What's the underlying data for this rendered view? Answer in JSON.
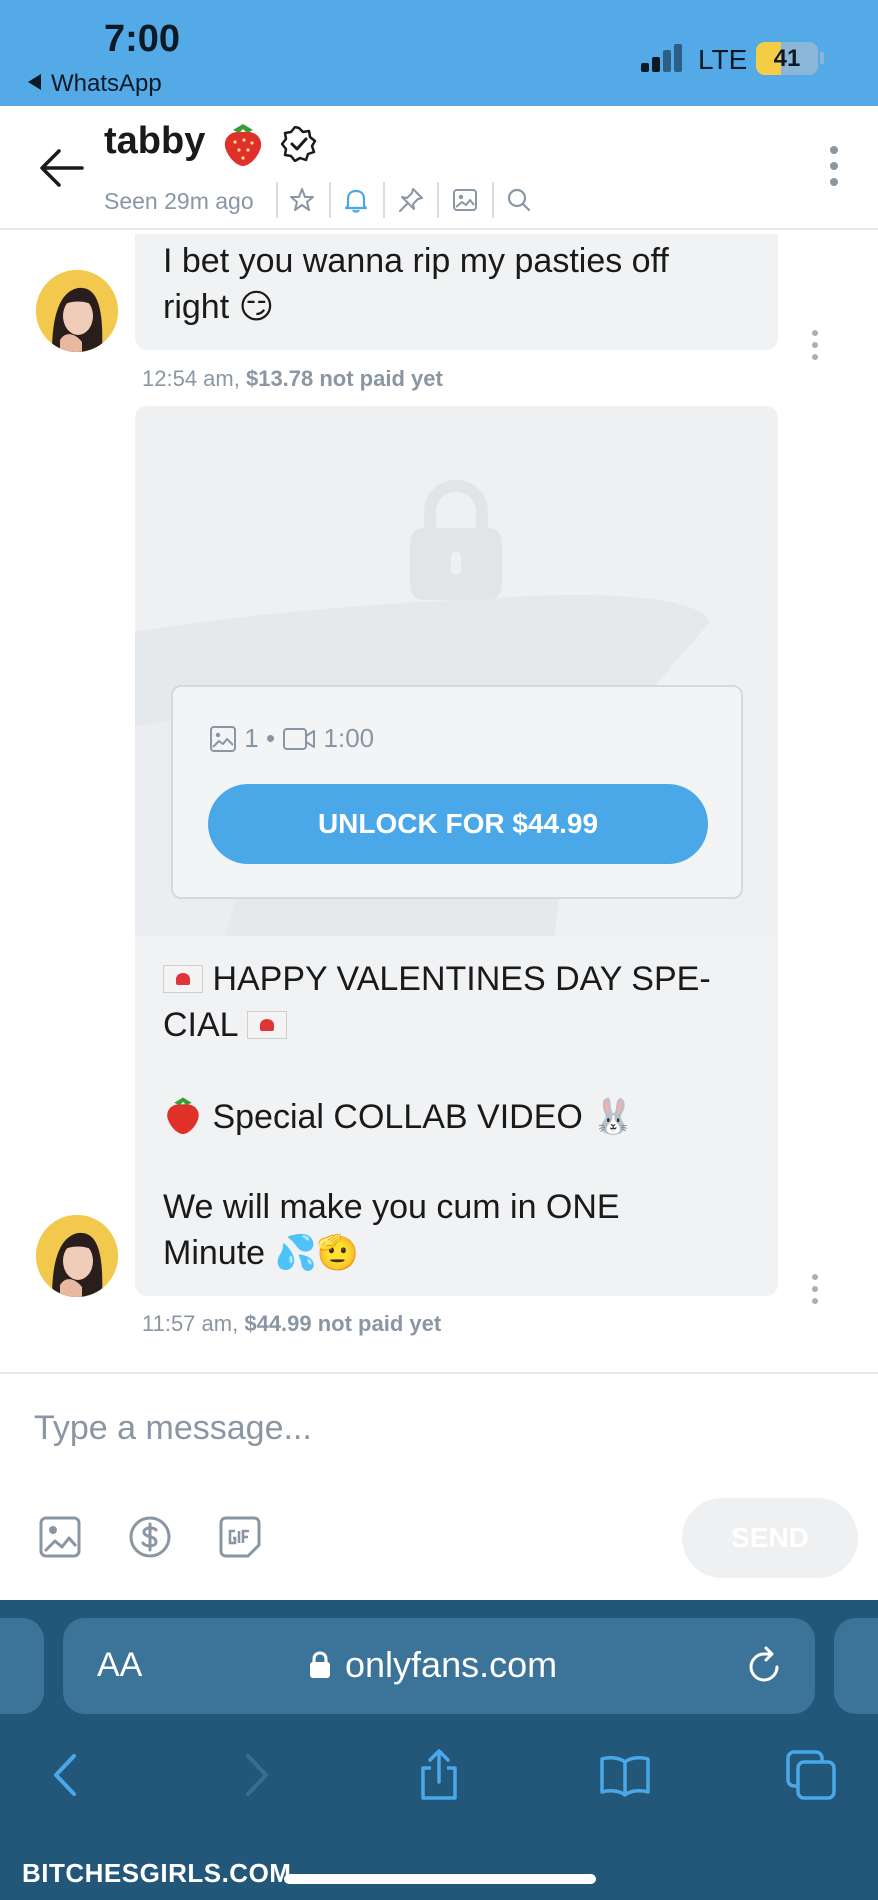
{
  "status_bar": {
    "time": "7:00",
    "back_app": "WhatsApp",
    "network": "LTE",
    "battery": "41",
    "battery_level": 0.41
  },
  "header": {
    "name": "tabby",
    "seen": "Seen 29m ago",
    "icons": [
      "back-arrow-icon",
      "strawberry-emoji",
      "verified-icon",
      "star-icon",
      "bell-icon",
      "pin-icon",
      "image-icon",
      "search-icon",
      "more-icon"
    ]
  },
  "messages": [
    {
      "lines": [
        "I bet you wanna rip my pasties off",
        "right 😏"
      ],
      "time": "12:54 am,",
      "price": "$13.78 not paid yet"
    },
    {
      "media": {
        "photo_count": "1",
        "separator": "•",
        "video_length": "1:00",
        "unlock_label": "UNLOCK FOR $44.99"
      },
      "caption": {
        "line1": "HAPPY VALENTINES DAY SPE-",
        "line2": "CIAL",
        "line3": "Special COLLAB VIDEO 🐰",
        "line4": "We will make you cum in ONE",
        "line5": "Minute 💦🫡"
      },
      "time": "11:57 am,",
      "price": "$44.99 not paid yet"
    }
  ],
  "composer": {
    "placeholder": "Type a message...",
    "send_label": "SEND",
    "icons": [
      "image-icon",
      "dollar-icon",
      "gif-icon"
    ]
  },
  "browser": {
    "text_size_label": "AA",
    "url": "onlyfans.com",
    "icons": [
      "lock-icon",
      "reload-icon",
      "back-icon",
      "forward-icon",
      "share-icon",
      "bookmarks-icon",
      "tabs-icon"
    ]
  },
  "watermark": "BITCHESGIRLS.COM",
  "colors": {
    "status_bar": "#54aae6",
    "accent": "#4aa8e8",
    "browser": "#23577a"
  }
}
